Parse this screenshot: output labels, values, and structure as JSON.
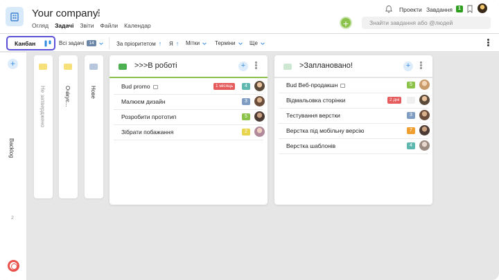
{
  "header": {
    "company": "Your company",
    "nav": [
      "Огляд",
      "Задачі",
      "Звіти",
      "Файли",
      "Календар"
    ],
    "active_nav": "Задачі",
    "projects": "Проекти",
    "tasks": "Завдання",
    "tasks_badge": "1",
    "search_placeholder": "Знайти завдання або @людей"
  },
  "toolbar": {
    "kanban": "Канбан",
    "all_tasks": "Всі задачі",
    "all_tasks_count": "14",
    "priority": "За пріоритетом",
    "me": "Я",
    "tags": "Мітки",
    "deadlines": "Терміни",
    "more": "Ще"
  },
  "rail": {
    "backlog": "Backlog",
    "count": "2"
  },
  "collapsed_columns": [
    {
      "label": "Не затверджено",
      "color": "#f5e07a"
    },
    {
      "label": "Очікує...",
      "color": "#f5e07a"
    },
    {
      "label": "Нове",
      "color": "#b7c6dc"
    }
  ],
  "columns": [
    {
      "title": ">>>В роботі",
      "color": "#4caf50",
      "line_color": "#8bc34a",
      "tasks": [
        {
          "name": "Bud promo",
          "due": "1 місяць",
          "count": "4",
          "count_color": "#5fb8b0",
          "avatar": "#5b4a3a"
        },
        {
          "name": "Малюєм дизайн",
          "count": "3",
          "count_color": "#7f9dc2",
          "avatar": "#6b4d3c"
        },
        {
          "name": "Розробити прототип",
          "count": "5",
          "count_color": "#8bc34a",
          "avatar": "#4c3b34"
        },
        {
          "name": "Зібрати побажання",
          "count": "2",
          "count_color": "#e8d44d",
          "avatar": "#b08a9a"
        }
      ]
    },
    {
      "title": ">Заплановано!",
      "color": "#cde7d3",
      "line_color": "#e5e5e5",
      "tasks": [
        {
          "name": "Bud Веб-продакшн",
          "count": "5",
          "count_color": "#8bc34a",
          "avatar": "#c99a6a"
        },
        {
          "name": "Відмальовка сторінки",
          "due": "2 дні",
          "count": "",
          "count_color": "#efefef",
          "avatar": "#5b4a3a"
        },
        {
          "name": "Тестування верстки",
          "count": "3",
          "count_color": "#7f9dc2",
          "avatar": "#6b4d3c"
        },
        {
          "name": "Верстка під мобільну версію",
          "count": "7",
          "count_color": "#f0a030",
          "avatar": "#4c3b34"
        },
        {
          "name": "Верстка шаблонів",
          "count": "4",
          "count_color": "#5fb8b0",
          "avatar": "#9a8a80"
        }
      ]
    }
  ]
}
